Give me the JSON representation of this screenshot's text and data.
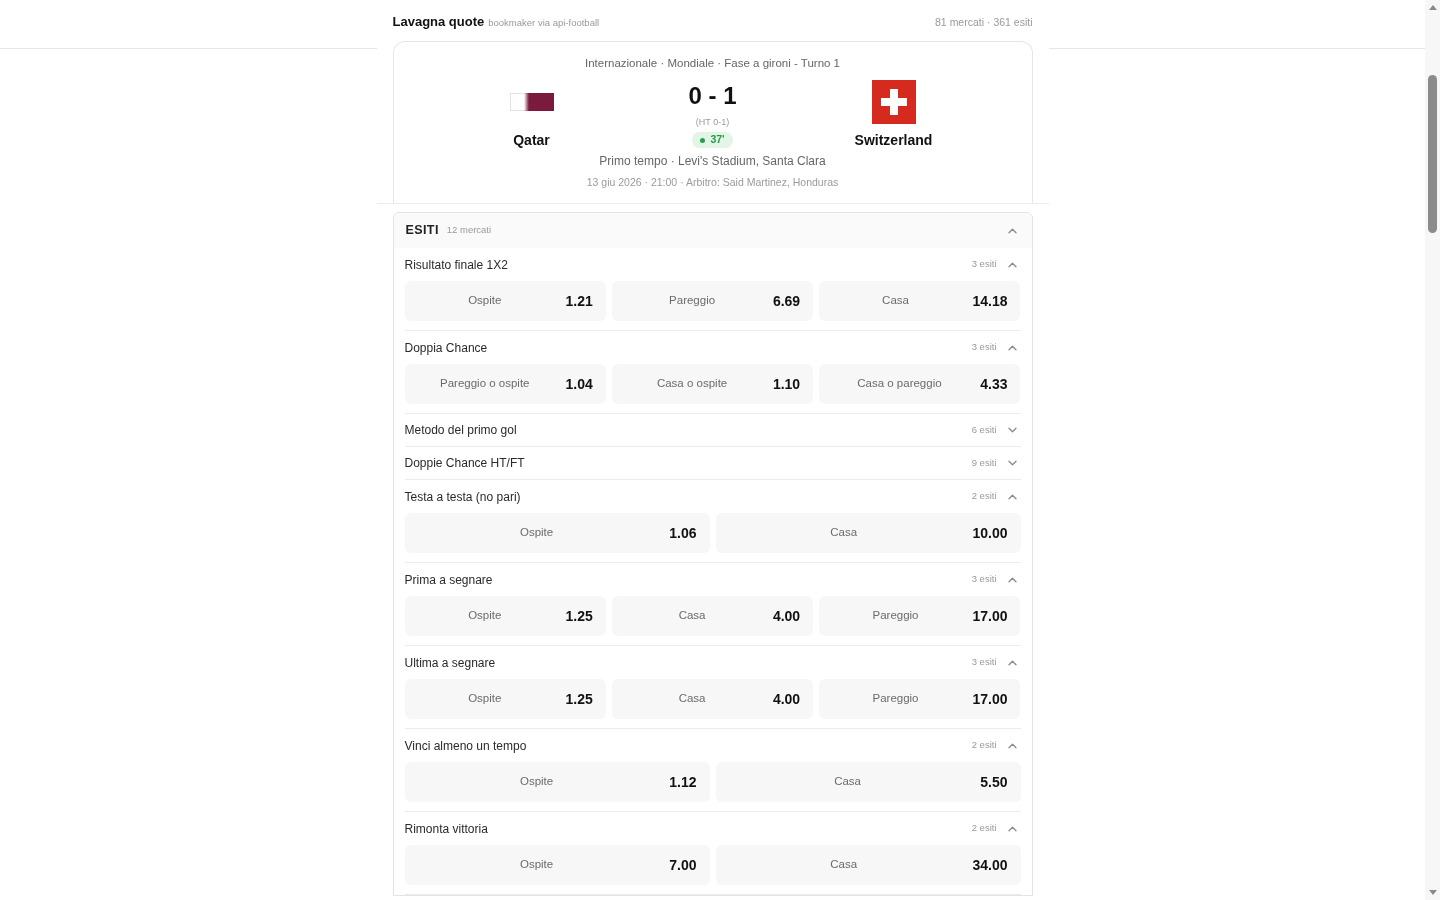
{
  "header": {
    "title": "Lavagna quote",
    "subtitle": "bookmaker via api-football",
    "summary": "81 mercati · 361 esiti"
  },
  "match": {
    "competition": "Internazionale · Mondiale · Fase a gironi - Turno 1",
    "teams": [
      {
        "name": "Qatar"
      },
      {
        "name": "Switzerland"
      }
    ],
    "score": "0 - 1",
    "halftime": "(HT 0-1)",
    "minute": "37'",
    "status": "Primo tempo · Levi's Stadium, Santa Clara",
    "details": "13 giu 2026 · 21:00 · Arbitro: Said Martinez, Honduras"
  },
  "outcomes_panel": {
    "title": "ESITI",
    "count": "12 mercati",
    "expanded": true,
    "markets": [
      {
        "name": "Risultato finale 1X2",
        "count": "3 esiti",
        "expanded": true,
        "outcomes": [
          {
            "label": "Ospite",
            "odds": "1.21"
          },
          {
            "label": "Pareggio",
            "odds": "6.69"
          },
          {
            "label": "Casa",
            "odds": "14.18"
          }
        ]
      },
      {
        "name": "Doppia Chance",
        "count": "3 esiti",
        "expanded": true,
        "outcomes": [
          {
            "label": "Pareggio o ospite",
            "odds": "1.04"
          },
          {
            "label": "Casa o ospite",
            "odds": "1.10"
          },
          {
            "label": "Casa o pareggio",
            "odds": "4.33"
          }
        ]
      },
      {
        "name": "Metodo del primo gol",
        "count": "6 esiti",
        "expanded": false
      },
      {
        "name": "Doppie Chance HT/FT",
        "count": "9 esiti",
        "expanded": false
      },
      {
        "name": "Testa a testa (no pari)",
        "count": "2 esiti",
        "expanded": true,
        "outcomes": [
          {
            "label": "Ospite",
            "odds": "1.06"
          },
          {
            "label": "Casa",
            "odds": "10.00"
          }
        ]
      },
      {
        "name": "Prima a segnare",
        "count": "3 esiti",
        "expanded": true,
        "outcomes": [
          {
            "label": "Ospite",
            "odds": "1.25"
          },
          {
            "label": "Casa",
            "odds": "4.00"
          },
          {
            "label": "Pareggio",
            "odds": "17.00"
          }
        ]
      },
      {
        "name": "Ultima a segnare",
        "count": "3 esiti",
        "expanded": true,
        "outcomes": [
          {
            "label": "Ospite",
            "odds": "1.25"
          },
          {
            "label": "Casa",
            "odds": "4.00"
          },
          {
            "label": "Pareggio",
            "odds": "17.00"
          }
        ]
      },
      {
        "name": "Vinci almeno un tempo",
        "count": "2 esiti",
        "expanded": true,
        "outcomes": [
          {
            "label": "Ospite",
            "odds": "1.12"
          },
          {
            "label": "Casa",
            "odds": "5.50"
          }
        ]
      },
      {
        "name": "Rimonta vittoria",
        "count": "2 esiti",
        "expanded": true,
        "outcomes": [
          {
            "label": "Ospite",
            "odds": "7.00"
          },
          {
            "label": "Casa",
            "odds": "34.00"
          }
        ]
      }
    ]
  }
}
